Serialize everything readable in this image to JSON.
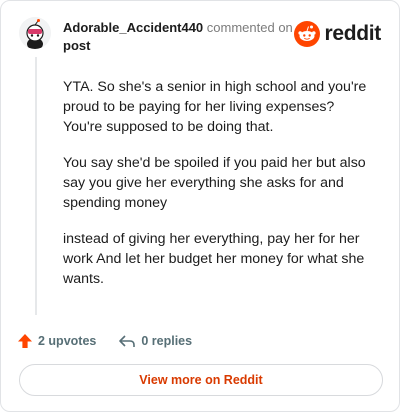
{
  "header": {
    "author": "Adorable_Accident440",
    "action_text": "commented on",
    "post_label": "post",
    "brand": "reddit"
  },
  "comment": {
    "paragraphs": [
      "YTA. So she's a senior in high school and you're proud to be paying for her living expenses? You're supposed to be doing that.",
      "You say she'd be spoiled if you paid her but also say you give her everything she asks for and spending money",
      "instead of giving her everything, pay her for her work And let her budget her money for what she wants."
    ]
  },
  "footer": {
    "upvotes": "2 upvotes",
    "replies": "0 replies",
    "view_more": "View more on Reddit"
  },
  "icons": {
    "upvote": "upvote-arrow-icon",
    "reply": "reply-arrow-icon",
    "brand": "reddit-snoo-icon"
  },
  "colors": {
    "brand_orange": "#ff4500",
    "link_orange": "#d93a00",
    "muted": "#576f76"
  }
}
